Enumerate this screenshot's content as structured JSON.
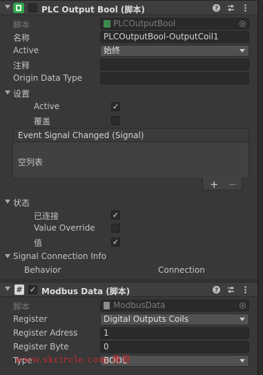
{
  "component1": {
    "title": "PLC Output Bool  (脚本)",
    "script_label": "脚本",
    "script_value": "PLCOutputBool",
    "name_label": "名称",
    "name_value": "PLCOutputBool-OutputCoil1",
    "active_label": "Active",
    "active_value": "始终",
    "comment_label": "注释",
    "comment_value": "",
    "origin_label": "Origin Data Type",
    "origin_value": "",
    "settings_label": "设置",
    "settings_active_label": "Active",
    "settings_active_checked": true,
    "override_label": "覆盖",
    "override_checked": false,
    "event_title": "Event Signal Changed (Signal)",
    "event_empty": "空列表",
    "add_label": "+",
    "remove_label": "−",
    "status_label": "状态",
    "connected_label": "已连接",
    "connected_checked": true,
    "value_override_label": "Value Override",
    "value_override_checked": false,
    "value_label": "值",
    "value_checked": true,
    "signal_info_label": "Signal Connection Info",
    "behavior_label": "Behavior",
    "connection_label": "Connection"
  },
  "component2": {
    "title": "Modbus Data  (脚本)",
    "script_label": "脚本",
    "script_value": "ModbusData",
    "register_label": "Register",
    "register_value": "Digital Outputs Coils",
    "register_address_label": "Register Adress",
    "register_address_value": "1",
    "register_byte_label": "Register Byte",
    "register_byte_value": "0",
    "type_label": "Type",
    "type_value": "BOOL"
  },
  "header_icons": [
    "help-icon",
    "presets-icon",
    "more-icon"
  ],
  "watermark": "www.skcircle.com 勇哥",
  "colors": {
    "background": "#383838",
    "header": "#3e3e3e",
    "field": "#2a2a2a",
    "dropdown": "#515151",
    "component_icon": "#2fa84f",
    "watermark": "#c62d2d"
  }
}
